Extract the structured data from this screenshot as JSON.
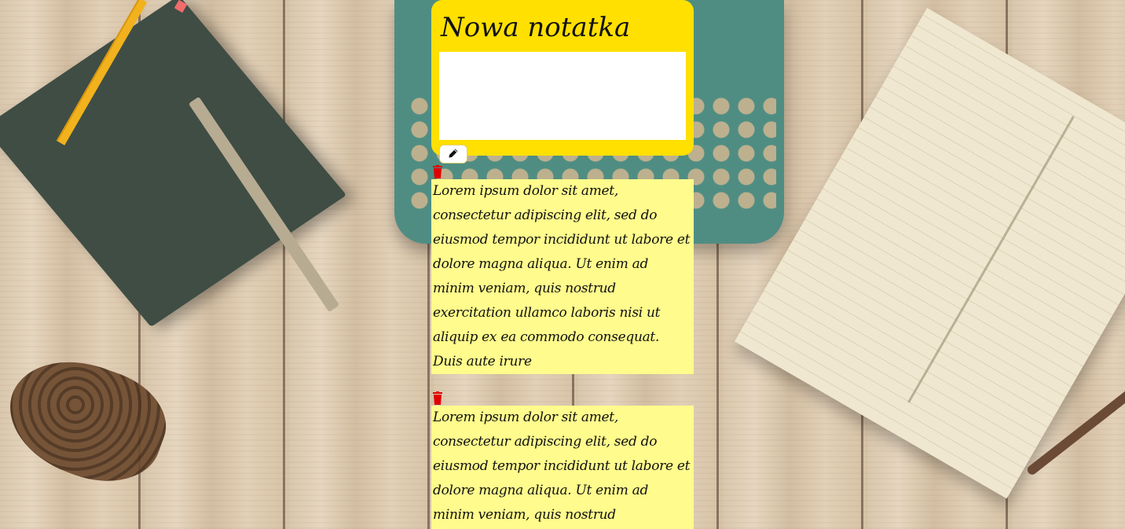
{
  "new_note": {
    "title": "Nowa notatka",
    "input_value": "",
    "add_button_icon": "pencil-icon"
  },
  "notes": [
    {
      "delete_icon": "trash-icon",
      "text": "Lorem ipsum dolor sit amet, consectetur adipiscing elit, sed do eiusmod tempor incididunt ut labore et dolore magna aliqua. Ut enim ad minim veniam, quis nostrud exercitation ullamco laboris nisi ut aliquip ex ea commodo consequat. Duis aute irure"
    },
    {
      "delete_icon": "trash-icon",
      "text": "Lorem ipsum dolor sit amet, consectetur adipiscing elit, sed do eiusmod tempor incididunt ut labore et dolore magna aliqua. Ut enim ad minim veniam, quis nostrud exercitation"
    }
  ],
  "colors": {
    "new_note_bg": "#ffe000",
    "note_bg": "#fffb8c",
    "delete_icon": "#e00000"
  }
}
